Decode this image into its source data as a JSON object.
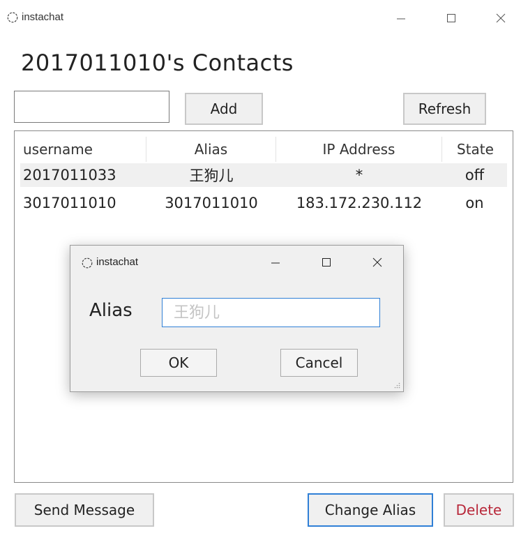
{
  "window": {
    "app_title": "instachat",
    "icon": "chat-bubble-icon",
    "controls": [
      "minimize-icon",
      "maximize-icon",
      "close-icon"
    ]
  },
  "page": {
    "title": "2017011010's Contacts"
  },
  "toolbar": {
    "add_input_value": "",
    "add_label": "Add",
    "refresh_label": "Refresh"
  },
  "table": {
    "columns": [
      "username",
      "Alias",
      "IP Address",
      "State"
    ],
    "rows": [
      {
        "username": "2017011033",
        "alias": "王狗儿",
        "ip": "*",
        "state": "off"
      },
      {
        "username": "3017011010",
        "alias": "3017011010",
        "ip": "183.172.230.112",
        "state": "on"
      }
    ]
  },
  "dialog": {
    "title": "instachat",
    "label": "Alias",
    "input_placeholder": "王狗儿",
    "ok_label": "OK",
    "cancel_label": "Cancel"
  },
  "footer": {
    "send_label": "Send Message",
    "change_alias_label": "Change Alias",
    "delete_label": "Delete"
  },
  "colors": {
    "accent": "#2f7fd6",
    "danger": "#b8283a",
    "row_highlight": "#f0f0f0"
  }
}
